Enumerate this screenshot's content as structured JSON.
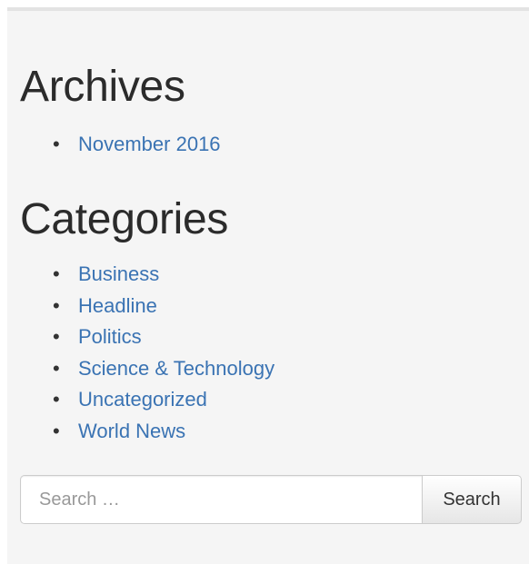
{
  "archives": {
    "title": "Archives",
    "items": [
      {
        "label": "November 2016"
      }
    ]
  },
  "categories": {
    "title": "Categories",
    "items": [
      {
        "label": "Business"
      },
      {
        "label": "Headline"
      },
      {
        "label": "Politics"
      },
      {
        "label": "Science & Technology"
      },
      {
        "label": "Uncategorized"
      },
      {
        "label": "World News"
      }
    ]
  },
  "search": {
    "placeholder": "Search …",
    "value": "",
    "button_label": "Search"
  },
  "colors": {
    "link": "#3a73b3",
    "panel_background": "#f5f5f5",
    "heading": "#2b2b2b"
  }
}
